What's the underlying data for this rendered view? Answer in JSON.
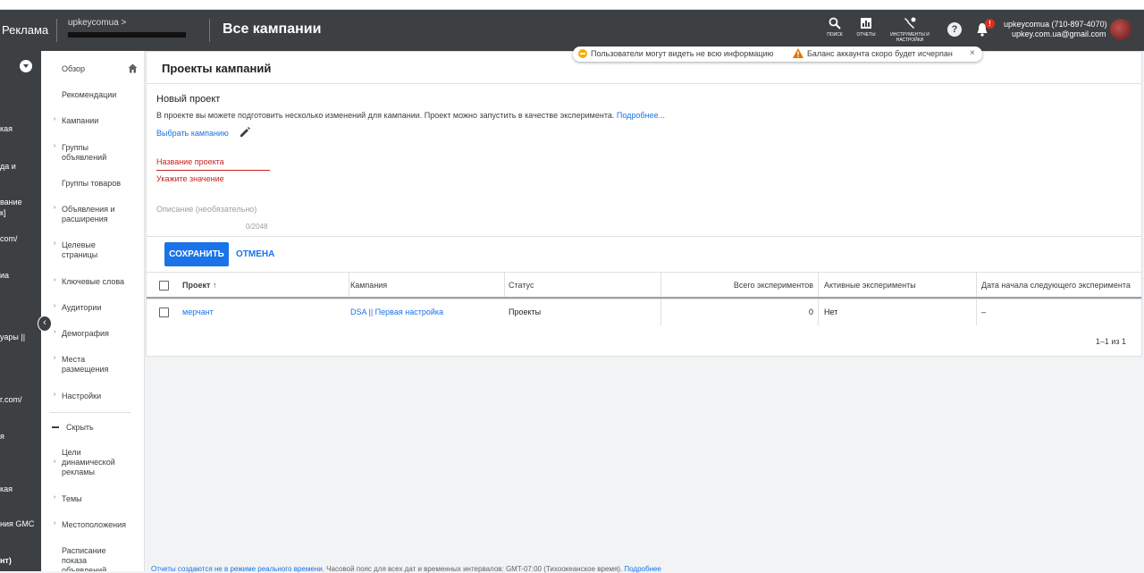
{
  "topbar": {
    "brand": "Реклама",
    "account_name": "upkeycomua",
    "account_chevron": ">",
    "page_title": "Все кампании",
    "tools": [
      {
        "icon": "search-icon",
        "label": "ПОИСК"
      },
      {
        "icon": "reports-icon",
        "label": "ОТЧЕТЫ"
      },
      {
        "icon": "wrench-icon",
        "label": "ИНСТРУМЕНТЫ И НАСТРОЙКИ"
      }
    ],
    "help_glyph": "?",
    "notification_badge": "!",
    "user_phone": "upkeycomua (710-897-4070)",
    "user_email": "upkey.com.ua@gmail.com"
  },
  "notice": {
    "text1": "Пользователи могут видеть не всю информацию",
    "text2": "Баланс аккаунта скоро будет исчерпан",
    "close": "×"
  },
  "rail": {
    "items": [
      "кая",
      "да и",
      "вание",
      "к]",
      "com/",
      "иа",
      "уары ||",
      "r.com/",
      "я",
      "кая",
      "ния GMC",
      "нт)"
    ]
  },
  "nav": {
    "items": [
      {
        "label": "Обзор",
        "arrow": false
      },
      {
        "label": "Рекомендации",
        "arrow": false
      },
      {
        "label": "Кампании",
        "arrow": true
      },
      {
        "label": "Группы объявлений",
        "arrow": true
      },
      {
        "label": "Группы товаров",
        "arrow": false
      },
      {
        "label": "Объявления и расширения",
        "arrow": true
      },
      {
        "label": "Целевые страницы",
        "arrow": true
      },
      {
        "label": "Ключевые слова",
        "arrow": true
      },
      {
        "label": "Аудитории",
        "arrow": true
      },
      {
        "label": "Демография",
        "arrow": true
      },
      {
        "label": "Места размещения",
        "arrow": true
      },
      {
        "label": "Настройки",
        "arrow": true
      },
      {
        "label": "Скрыть",
        "arrow": false
      },
      {
        "label": "Цели динамической рекламы",
        "arrow": true
      },
      {
        "label": "Темы",
        "arrow": true
      },
      {
        "label": "Местоположения",
        "arrow": true
      },
      {
        "label": "Расписание показа объявлений",
        "arrow": false
      }
    ]
  },
  "panel": {
    "title": "Проекты кампаний",
    "new_project": "Новый проект",
    "description": "В проекте вы можете подготовить несколько изменений для кампании. Проект можно запустить в качестве эксперимента.",
    "more_link": "Подробнее...",
    "choose_campaign": "Выбрать кампанию",
    "name_label": "Название проекта",
    "name_error": "Укажите значение",
    "desc_label": "Описание (необязательно)",
    "desc_counter": "0/2048",
    "save": "СОХРАНИТЬ",
    "cancel": "ОТМЕНА"
  },
  "table": {
    "headers": [
      "Проект",
      "Кампания",
      "Статус",
      "Всего экспериментов",
      "Активные эксперименты",
      "Дата начала следующего эксперимента"
    ],
    "sort_arrow": "↑",
    "rows": [
      {
        "project": "мерчант",
        "campaign": "DSA || Первая настройка",
        "status": "Проекты",
        "total": "0",
        "active": "Нет",
        "next_date": "–"
      }
    ],
    "pager": "1–1 из 1"
  },
  "footer": {
    "text1": "Отчеты создаются не в режиме реального времени.",
    "text2": "Часовой пояс для всех дат и временных интервалов: GMT-07:00 (Тихоокеанское время).",
    "link": "Подробнее"
  },
  "colors": {
    "topbar": "#3c4043",
    "accent": "#1a73e8",
    "error": "#c5221f",
    "warning": "#f9ab00"
  }
}
